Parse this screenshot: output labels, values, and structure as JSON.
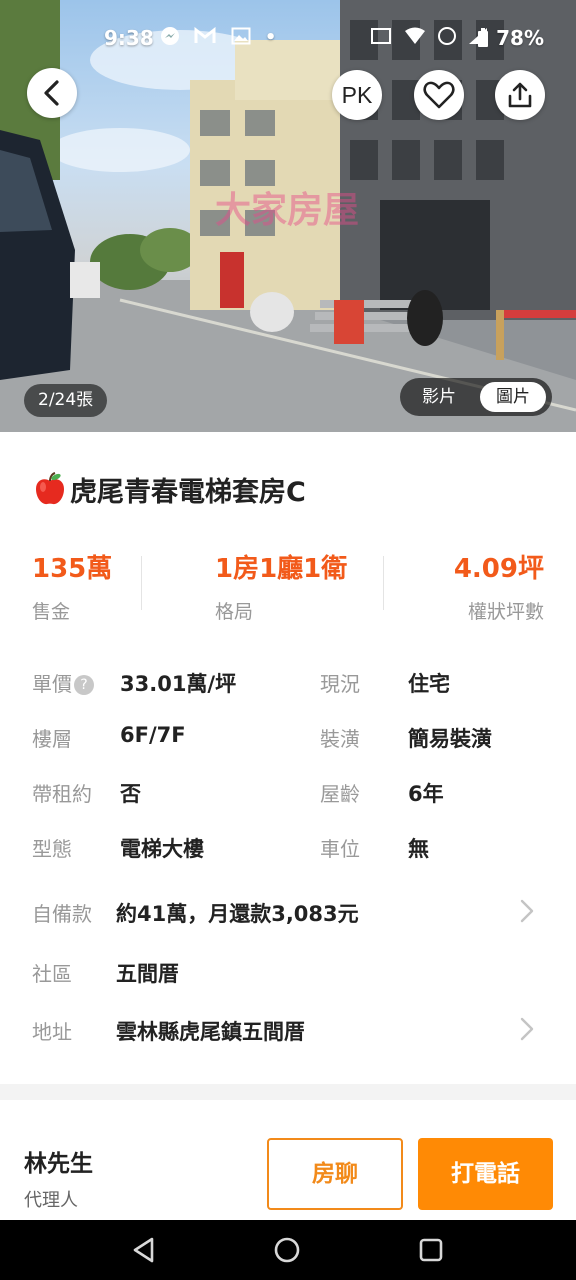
{
  "status_bar": {
    "time": "9:38",
    "battery": "78%",
    "icons": [
      "messenger-icon",
      "gmail-icon",
      "gallery-icon",
      "dot"
    ],
    "system_icons": [
      "cast-icon",
      "wifi-icon",
      "lte-icon",
      "signal-icon",
      "battery-icon"
    ]
  },
  "hero": {
    "pk_label": "PK",
    "watermark": "大家房屋",
    "photo_counter": "2/24張",
    "media_toggle": {
      "video": "影片",
      "photo": "圖片",
      "selected": "photo"
    }
  },
  "listing": {
    "title": "虎尾青春電梯套房C",
    "stats": [
      {
        "value": "135萬",
        "label": "售金"
      },
      {
        "value": "1房1廳1衛",
        "label": "格局"
      },
      {
        "value": "4.09坪",
        "label": "權狀坪數"
      }
    ],
    "details_left": [
      {
        "key": "單價",
        "value": "33.01萬/坪",
        "help": "?"
      },
      {
        "key": "樓層",
        "value": "6F/7F"
      },
      {
        "key": "帶租約",
        "value": "否"
      },
      {
        "key": "型態",
        "value": "電梯大樓"
      }
    ],
    "details_right": [
      {
        "key": "現況",
        "value": "住宅"
      },
      {
        "key": "裝潢",
        "value": "簡易裝潢"
      },
      {
        "key": "屋齡",
        "value": "6年"
      },
      {
        "key": "車位",
        "value": "無"
      }
    ],
    "down_payment": {
      "key": "自備款",
      "value": "約41萬，月還款3,083元"
    },
    "community": {
      "key": "社區",
      "value": "五間厝"
    },
    "address": {
      "key": "地址",
      "value": "雲林縣虎尾鎮五間厝"
    }
  },
  "action_bar": {
    "agent_name": "林先生",
    "agent_role": "代理人",
    "chat_label": "房聊",
    "call_label": "打電話"
  },
  "colors": {
    "price_accent": "#f25a1a",
    "button_orange": "#ff8a05",
    "outline_orange": "#f28a1a"
  }
}
